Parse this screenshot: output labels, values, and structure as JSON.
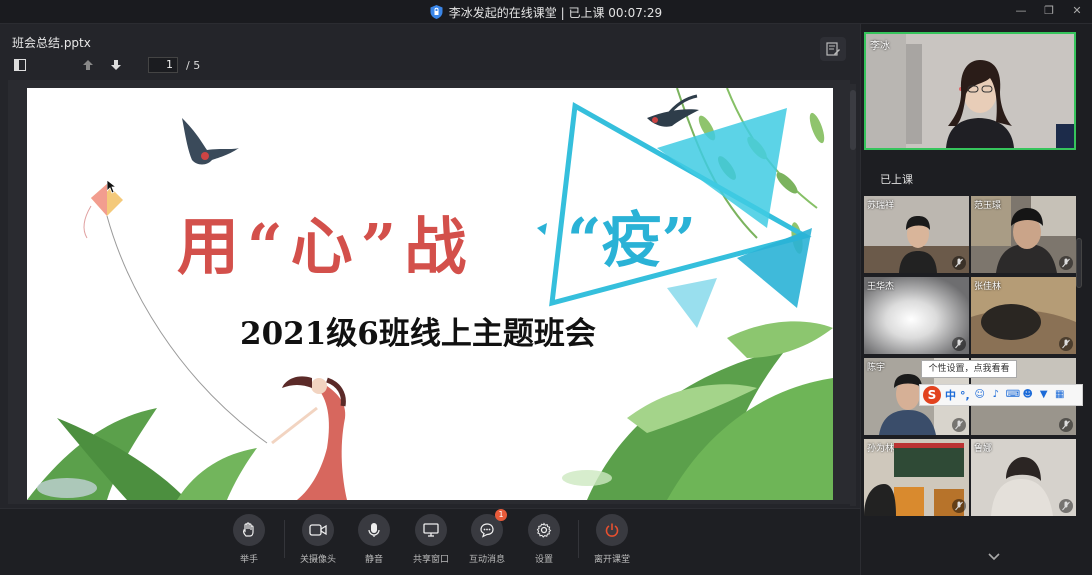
{
  "window": {
    "title": "李冰发起的在线课堂 | 已上课 00:07:29"
  },
  "document": {
    "filename": "班会总结.pptx",
    "current_page": "1",
    "total_pages": "/ 5"
  },
  "slide": {
    "headline": "用“心”战",
    "headline_accent": "“疫”",
    "subtitle": "2021级6班线上主题班会"
  },
  "controls": [
    {
      "label": "举手",
      "icon": "hand-icon"
    },
    {
      "label": "关摄像头",
      "icon": "camera-icon"
    },
    {
      "label": "静音",
      "icon": "mic-icon"
    },
    {
      "label": "共享窗口",
      "icon": "screen-share-icon"
    },
    {
      "label": "互动消息",
      "icon": "chat-icon",
      "badge": "1"
    },
    {
      "label": "设置",
      "icon": "gear-icon"
    },
    {
      "label": "离开课堂",
      "icon": "power-icon"
    }
  ],
  "teacher": {
    "name": "李冰"
  },
  "section_label": "已上课",
  "students": [
    {
      "name": "苏瑞祥"
    },
    {
      "name": "范玉璟"
    },
    {
      "name": "王华杰"
    },
    {
      "name": "张佳林"
    },
    {
      "name": "陈宇"
    },
    {
      "name": ""
    },
    {
      "name": "孙为林"
    },
    {
      "name": "鲁娜"
    }
  ],
  "tooltip": "个性设置，点我看看",
  "ime": {
    "logo": "S",
    "mode": "中",
    "punct": "°,"
  },
  "colors": {
    "accent_green": "#36c45c",
    "leave_red": "#e8502f",
    "badge": "#e85b3a"
  }
}
